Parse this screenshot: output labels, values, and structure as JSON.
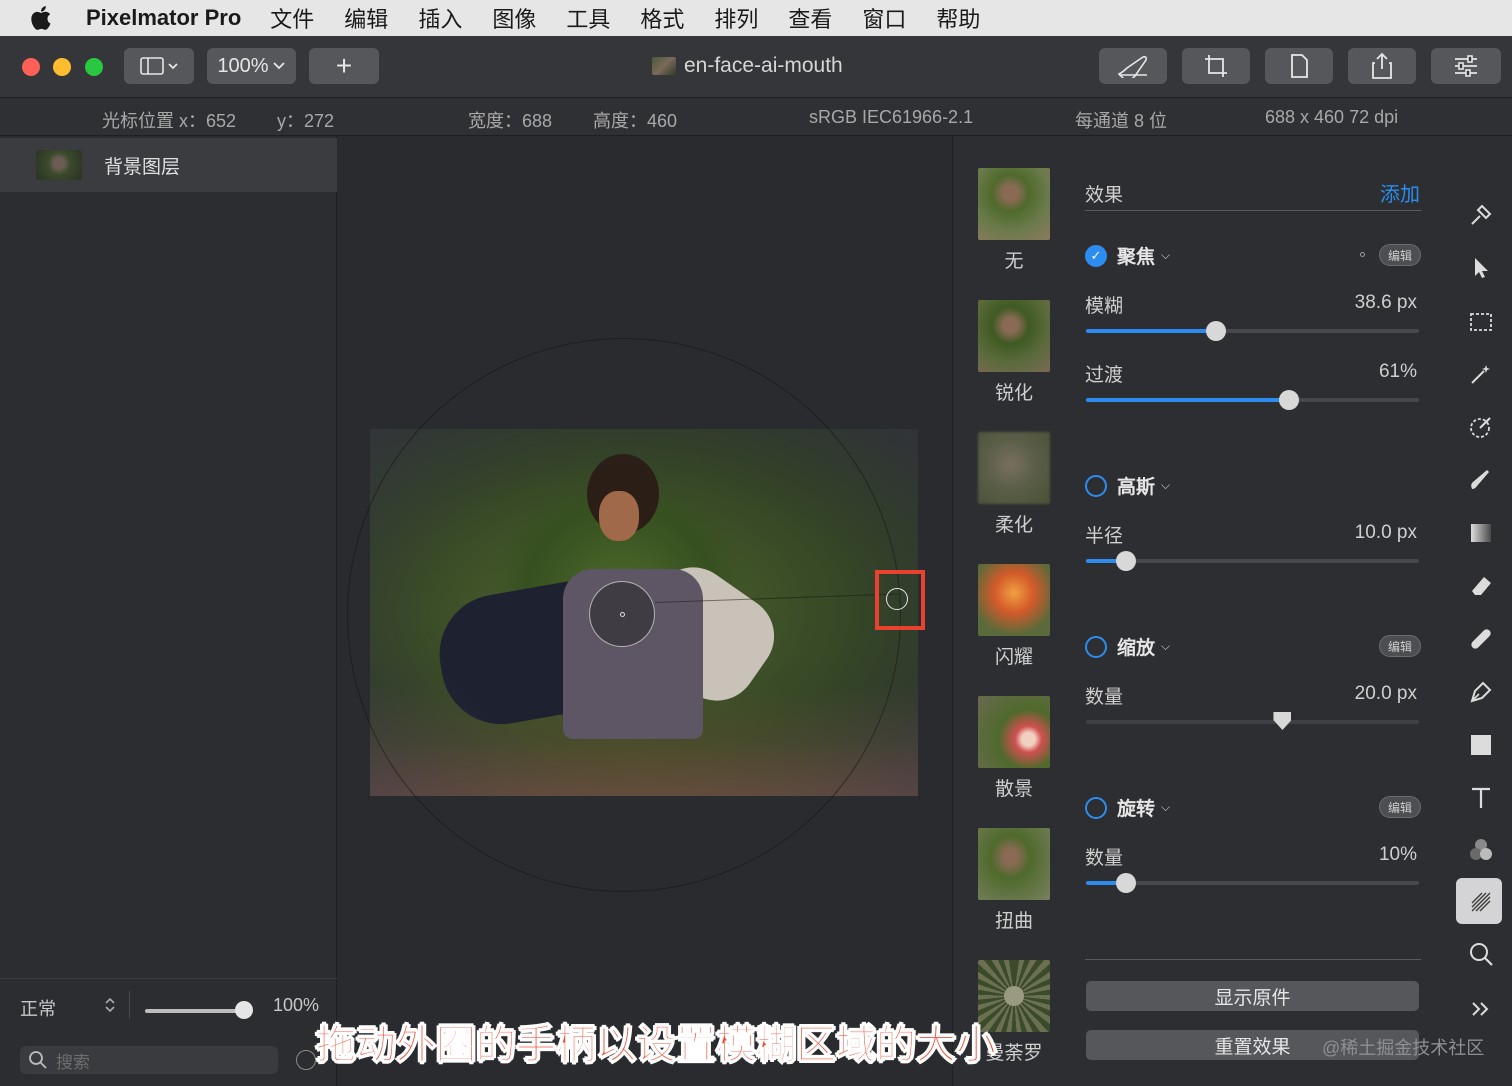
{
  "menubar": {
    "app_name": "Pixelmator Pro",
    "items": [
      "文件",
      "编辑",
      "插入",
      "图像",
      "工具",
      "格式",
      "排列",
      "查看",
      "窗口",
      "帮助"
    ]
  },
  "toolbar": {
    "zoom": "100%",
    "add_label": "+",
    "document_title": "en-face-ai-mouth"
  },
  "infobar": {
    "cursor_x": "光标位置 x：652",
    "cursor_y": "y：272",
    "width": "宽度：688",
    "height": "高度：460",
    "color_profile": "sRGB IEC61966-2.1",
    "bit_depth": "每通道 8 位",
    "size_dpi": "688 x 460 72 dpi"
  },
  "layers": {
    "items": [
      {
        "name": "背景图层"
      }
    ],
    "blend_mode": "正常",
    "opacity": "100%",
    "opacity_fraction": 1.0,
    "search_placeholder": "搜索"
  },
  "presets": [
    {
      "label": "无"
    },
    {
      "label": "锐化"
    },
    {
      "label": "柔化"
    },
    {
      "label": "闪耀"
    },
    {
      "label": "散景"
    },
    {
      "label": "扭曲"
    },
    {
      "label": "曼荼罗"
    }
  ],
  "effects": {
    "title": "效果",
    "add_label": "添加",
    "edit_label": "编辑",
    "focus": {
      "name": "聚焦",
      "enabled": true,
      "blur_label": "模糊",
      "blur_value": "38.6 px",
      "blur_fraction": 0.39,
      "transition_label": "过渡",
      "transition_value": "61%",
      "transition_fraction": 0.61
    },
    "gaussian": {
      "name": "高斯",
      "enabled": false,
      "radius_label": "半径",
      "radius_value": "10.0 px",
      "radius_fraction": 0.12
    },
    "zoom": {
      "name": "缩放",
      "enabled": false,
      "amount_label": "数量",
      "amount_value": "20.0 px",
      "amount_fraction": 0.59
    },
    "spin": {
      "name": "旋转",
      "enabled": false,
      "amount_label": "数量",
      "amount_value": "10%",
      "amount_fraction": 0.12
    },
    "show_original_label": "显示原件",
    "reset_label": "重置效果"
  },
  "caption": "拖动外圈的手柄以设置模糊区域的大小",
  "watermark": "@稀土掘金技术社区",
  "colors": {
    "accent": "#2c8cf0",
    "highlight": "#e8412f",
    "close": "#fe5f57",
    "minimize": "#febc2e",
    "zoom": "#28c840"
  }
}
